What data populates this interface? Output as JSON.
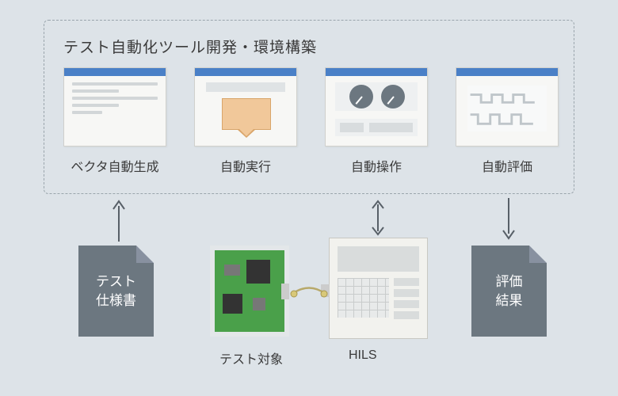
{
  "section_title": "テスト自動化ツール開発・環境構築",
  "cards": {
    "vector_gen": "ベクタ自動生成",
    "auto_exec": "自動実行",
    "auto_operate": "自動操作",
    "auto_eval": "自動評価"
  },
  "docs": {
    "test_spec": "テスト\n仕様書",
    "eval_result": "評価\n結果"
  },
  "hardware": {
    "test_target": "テスト対象",
    "hils": "HILS"
  }
}
